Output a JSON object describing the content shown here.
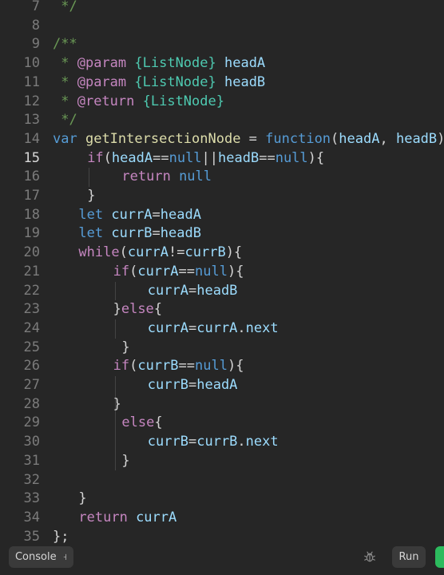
{
  "editor": {
    "active_line": "15",
    "lines": [
      {
        "n": "7",
        "indent": 0,
        "tokens": [
          {
            "t": " */",
            "c": "com"
          }
        ]
      },
      {
        "n": "8",
        "indent": 0,
        "tokens": []
      },
      {
        "n": "9",
        "indent": 0,
        "tokens": [
          {
            "t": "/**",
            "c": "com"
          }
        ]
      },
      {
        "n": "10",
        "indent": 0,
        "tokens": [
          {
            "t": " * ",
            "c": "com"
          },
          {
            "t": "@param",
            "c": "tag"
          },
          {
            "t": " ",
            "c": "com"
          },
          {
            "t": "{ListNode}",
            "c": "type"
          },
          {
            "t": " headA",
            "c": "param"
          }
        ]
      },
      {
        "n": "11",
        "indent": 0,
        "tokens": [
          {
            "t": " * ",
            "c": "com"
          },
          {
            "t": "@param",
            "c": "tag"
          },
          {
            "t": " ",
            "c": "com"
          },
          {
            "t": "{ListNode}",
            "c": "type"
          },
          {
            "t": " headB",
            "c": "param"
          }
        ]
      },
      {
        "n": "12",
        "indent": 0,
        "tokens": [
          {
            "t": " * ",
            "c": "com"
          },
          {
            "t": "@return",
            "c": "tag"
          },
          {
            "t": " ",
            "c": "com"
          },
          {
            "t": "{ListNode}",
            "c": "type"
          }
        ]
      },
      {
        "n": "13",
        "indent": 0,
        "tokens": [
          {
            "t": " */",
            "c": "com"
          }
        ]
      },
      {
        "n": "14",
        "indent": 0,
        "tokens": [
          {
            "t": "var",
            "c": "kw"
          },
          {
            "t": " ",
            "c": "op"
          },
          {
            "t": "getIntersectionNode",
            "c": "fn"
          },
          {
            "t": " = ",
            "c": "op"
          },
          {
            "t": "function",
            "c": "kw"
          },
          {
            "t": "(",
            "c": "op"
          },
          {
            "t": "headA",
            "c": "var"
          },
          {
            "t": ", ",
            "c": "op"
          },
          {
            "t": "headB",
            "c": "var"
          },
          {
            "t": ") {",
            "c": "op"
          }
        ]
      },
      {
        "n": "15",
        "indent": 1,
        "tokens": [
          {
            "t": "if",
            "c": "ctl"
          },
          {
            "t": "(",
            "c": "op"
          },
          {
            "t": "headA",
            "c": "var"
          },
          {
            "t": "==",
            "c": "op"
          },
          {
            "t": "null",
            "c": "lit"
          },
          {
            "t": "||",
            "c": "op"
          },
          {
            "t": "headB",
            "c": "var"
          },
          {
            "t": "==",
            "c": "op"
          },
          {
            "t": "null",
            "c": "lit"
          },
          {
            "t": "){",
            "c": "op"
          }
        ]
      },
      {
        "n": "16",
        "indent": 2,
        "tokens": [
          {
            "t": "return",
            "c": "ctl"
          },
          {
            "t": " ",
            "c": "op"
          },
          {
            "t": "null",
            "c": "lit"
          }
        ]
      },
      {
        "n": "17",
        "indent": 1,
        "tokens": [
          {
            "t": "}",
            "c": "op"
          }
        ]
      },
      {
        "n": "18",
        "indent": 1,
        "tokens": [
          {
            "t": "let",
            "c": "kw"
          },
          {
            "t": " ",
            "c": "op"
          },
          {
            "t": "currA",
            "c": "var"
          },
          {
            "t": "=",
            "c": "op"
          },
          {
            "t": "headA",
            "c": "var"
          }
        ]
      },
      {
        "n": "19",
        "indent": 1,
        "tokens": [
          {
            "t": "let",
            "c": "kw"
          },
          {
            "t": " ",
            "c": "op"
          },
          {
            "t": "currB",
            "c": "var"
          },
          {
            "t": "=",
            "c": "op"
          },
          {
            "t": "headB",
            "c": "var"
          }
        ]
      },
      {
        "n": "20",
        "indent": 1,
        "tokens": [
          {
            "t": "while",
            "c": "ctl"
          },
          {
            "t": "(",
            "c": "op"
          },
          {
            "t": "currA",
            "c": "var"
          },
          {
            "t": "!=",
            "c": "op"
          },
          {
            "t": "currB",
            "c": "var"
          },
          {
            "t": "){",
            "c": "op"
          }
        ]
      },
      {
        "n": "21",
        "indent": 2,
        "tokens": [
          {
            "t": "if",
            "c": "ctl"
          },
          {
            "t": "(",
            "c": "op"
          },
          {
            "t": "currA",
            "c": "var"
          },
          {
            "t": "==",
            "c": "op"
          },
          {
            "t": "null",
            "c": "lit"
          },
          {
            "t": "){",
            "c": "op"
          }
        ]
      },
      {
        "n": "22",
        "indent": 3,
        "tokens": [
          {
            "t": "currA",
            "c": "var"
          },
          {
            "t": "=",
            "c": "op"
          },
          {
            "t": "headB",
            "c": "var"
          }
        ]
      },
      {
        "n": "23",
        "indent": 2,
        "tokens": [
          {
            "t": "}",
            "c": "op"
          },
          {
            "t": "else",
            "c": "ctl"
          },
          {
            "t": "{",
            "c": "op"
          }
        ]
      },
      {
        "n": "24",
        "indent": 3,
        "tokens": [
          {
            "t": "currA",
            "c": "var"
          },
          {
            "t": "=",
            "c": "op"
          },
          {
            "t": "currA",
            "c": "var"
          },
          {
            "t": ".",
            "c": "op"
          },
          {
            "t": "next",
            "c": "var"
          }
        ]
      },
      {
        "n": "25",
        "indent": 2,
        "tokens": [
          {
            "t": "}",
            "c": "op"
          }
        ]
      },
      {
        "n": "26",
        "indent": 2,
        "tokens": [
          {
            "t": "if",
            "c": "ctl"
          },
          {
            "t": "(",
            "c": "op"
          },
          {
            "t": "currB",
            "c": "var"
          },
          {
            "t": "==",
            "c": "op"
          },
          {
            "t": "null",
            "c": "lit"
          },
          {
            "t": "){",
            "c": "op"
          }
        ]
      },
      {
        "n": "27",
        "indent": 3,
        "tokens": [
          {
            "t": "currB",
            "c": "var"
          },
          {
            "t": "=",
            "c": "op"
          },
          {
            "t": "headA",
            "c": "var"
          }
        ]
      },
      {
        "n": "28",
        "indent": 2,
        "tokens": [
          {
            "t": "}",
            "c": "op"
          }
        ]
      },
      {
        "n": "29",
        "indent": 2,
        "tokens": [
          {
            "t": "else",
            "c": "ctl"
          },
          {
            "t": "{",
            "c": "op"
          }
        ]
      },
      {
        "n": "30",
        "indent": 3,
        "tokens": [
          {
            "t": "currB",
            "c": "var"
          },
          {
            "t": "=",
            "c": "op"
          },
          {
            "t": "currB",
            "c": "var"
          },
          {
            "t": ".",
            "c": "op"
          },
          {
            "t": "next",
            "c": "var"
          }
        ]
      },
      {
        "n": "31",
        "indent": 2,
        "tokens": [
          {
            "t": "}",
            "c": "op"
          }
        ]
      },
      {
        "n": "32",
        "indent": 0,
        "tokens": []
      },
      {
        "n": "33",
        "indent": 1,
        "tokens": [
          {
            "t": "}",
            "c": "op"
          }
        ]
      },
      {
        "n": "34",
        "indent": 1,
        "tokens": [
          {
            "t": "return",
            "c": "ctl"
          },
          {
            "t": " ",
            "c": "op"
          },
          {
            "t": "currA",
            "c": "var"
          }
        ]
      },
      {
        "n": "35",
        "indent": 0,
        "tokens": [
          {
            "t": "};",
            "c": "op"
          }
        ]
      }
    ]
  },
  "toolbar": {
    "console_label": "Console",
    "console_chevron": "⌄",
    "debug_icon": "bug-icon",
    "run_label": "Run",
    "submit_color": "#2cbb5d"
  }
}
